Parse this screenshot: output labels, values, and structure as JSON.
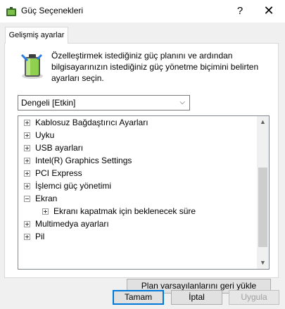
{
  "window": {
    "title": "Güç Seçenekleri",
    "help_label": "?",
    "close_label": "✕"
  },
  "tab": {
    "label": "Gelişmiş ayarlar"
  },
  "description": "Özelleştirmek istediğiniz güç planını ve ardından bilgisayarınızın istediğiniz güç yönetme biçimini belirten ayarları seçin.",
  "plan_select": {
    "value": "Dengeli [Etkin]"
  },
  "tree": {
    "items": [
      {
        "label": "Kablosuz Bağdaştırıcı Ayarları",
        "state": "collapsed"
      },
      {
        "label": "Uyku",
        "state": "collapsed"
      },
      {
        "label": "USB ayarları",
        "state": "collapsed"
      },
      {
        "label": "Intel(R) Graphics Settings",
        "state": "collapsed"
      },
      {
        "label": "PCI Express",
        "state": "collapsed"
      },
      {
        "label": "İşlemci güç yönetimi",
        "state": "collapsed"
      },
      {
        "label": "Ekran",
        "state": "expanded"
      },
      {
        "label": "Ekranı kapatmak için beklenecek süre",
        "state": "collapsed",
        "child": true
      },
      {
        "label": "Multimedya ayarları",
        "state": "collapsed"
      },
      {
        "label": "Pil",
        "state": "collapsed"
      }
    ]
  },
  "buttons": {
    "restore": "Plan varsayılanlarını geri yükle",
    "ok": "Tamam",
    "cancel": "İptal",
    "apply": "Uygula"
  }
}
